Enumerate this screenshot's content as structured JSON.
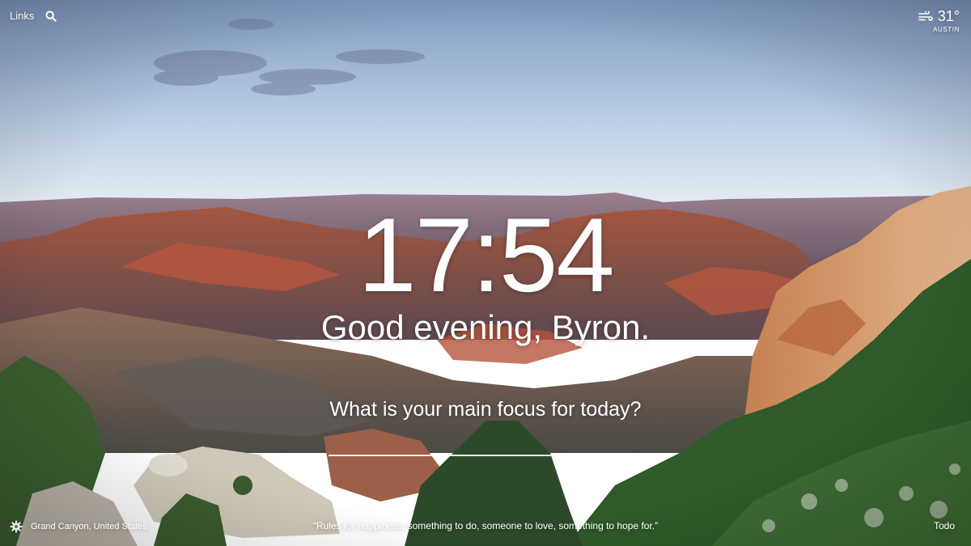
{
  "top_bar": {
    "links_label": "Links",
    "search_icon": "search-icon"
  },
  "weather": {
    "icon": "wind-icon",
    "temperature": "31°",
    "location": "AUSTIN"
  },
  "center": {
    "time": "17:54",
    "greeting": "Good evening, Byron.",
    "focus_prompt": "What is your main focus for today?",
    "focus_value": ""
  },
  "footer": {
    "settings_icon": "gear-icon",
    "photo_location": "Grand Canyon, United States",
    "quote": "“Rules for happiness: something to do, someone to love, something to hope for.”",
    "todo_label": "Todo"
  },
  "colors": {
    "sky_top": "#8aa2c6",
    "sky_horizon": "#dfe9f3",
    "canyon_red": "#b9543f",
    "canyon_shadow": "#5b4b55",
    "vegetation": "#2f5a2a",
    "text": "#ffffff"
  }
}
